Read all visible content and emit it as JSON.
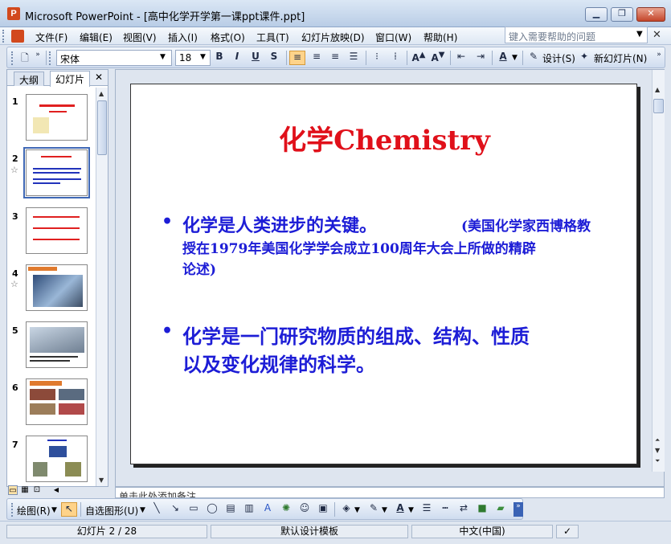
{
  "window": {
    "title": "Microsoft PowerPoint - [高中化学开学第一课ppt课件.ppt]",
    "app_icon": "P",
    "minimize_icon": "minimize-icon",
    "maximize_icon": "restore-icon",
    "close_icon": "close-icon"
  },
  "menubar": {
    "items": [
      "文件(F)",
      "编辑(E)",
      "视图(V)",
      "插入(I)",
      "格式(O)",
      "工具(T)",
      "幻灯片放映(D)",
      "窗口(W)",
      "帮助(H)"
    ],
    "help_placeholder": "键入需要帮助的问题"
  },
  "toolbar": {
    "font_name": "宋体",
    "font_size": "18",
    "bold": "B",
    "italic": "I",
    "underline": "U",
    "shadow": "S",
    "design_label": "设计(S)",
    "new_slide_label": "新幻灯片(N)"
  },
  "left_pane": {
    "tabs": [
      "大纲",
      "幻灯片"
    ],
    "slide_numbers": [
      "1",
      "2",
      "3",
      "4",
      "5",
      "6",
      "7"
    ],
    "selected_slide": 2,
    "animated_marker": "☆"
  },
  "slide": {
    "title": "化学Chemistry",
    "bullet1_main": "化学是人类进步的关键。",
    "bullet1_note_line1": "(美国化学家西博格教",
    "bullet1_note_line2": "授在1979年美国化学学会成立100周年大会上所做的精辟",
    "bullet1_note_line3": "论述)",
    "bullet2_line1": "化学是一门研究物质的组成、结构、性质",
    "bullet2_line2": "以及变化规律的科学。"
  },
  "notes": {
    "placeholder": "单击此处添加备注"
  },
  "drawbar": {
    "draw_label": "绘图(R)",
    "autoshapes_label": "自选图形(U)"
  },
  "statusbar": {
    "slide_position": "幻灯片 2 / 28",
    "template": "默认设计模板",
    "language": "中文(中国)"
  },
  "colors": {
    "title_red": "#e0101a",
    "bullet_blue": "#1d1dd6",
    "selection_blue": "#3f68b5",
    "active_button": "#ffd38a"
  }
}
